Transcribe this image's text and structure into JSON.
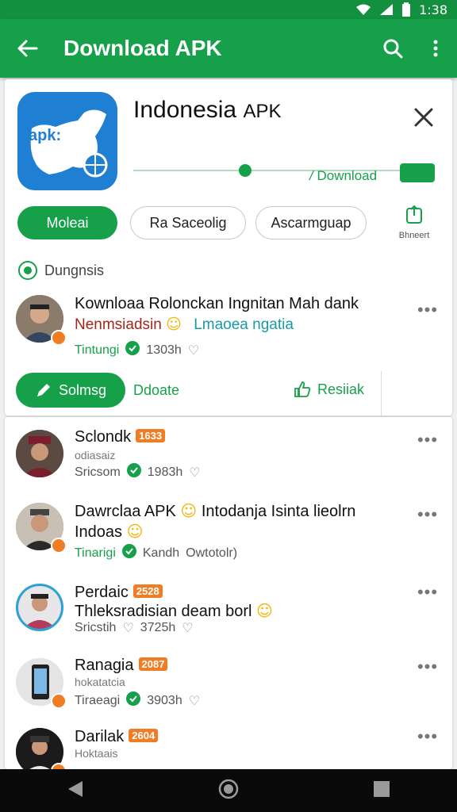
{
  "status_bar": {
    "time": "1:38"
  },
  "app_bar": {
    "title": "Download APK"
  },
  "app": {
    "icon_text": "apk:",
    "title": "Indonesia",
    "title_suffix": "APK",
    "download_label": "Download",
    "progress": 0.37
  },
  "chips": [
    "Moleai",
    "Ra Saceolig",
    "Ascarmguap"
  ],
  "share": {
    "label": "Bhneert"
  },
  "section": {
    "title": "Dungnsis"
  },
  "featured_post": {
    "title": "Kownloaa Rolonckan Ingnitan Mah dank",
    "sub_user": "Nenmsiadsin",
    "sub_text": "Lmaoea ngatia",
    "meta_name": "Tintungi",
    "meta_time": "1303h"
  },
  "actions": {
    "primary": "Solmsg",
    "secondary": "Ddoate",
    "like": "Resiiak"
  },
  "posts": [
    {
      "name": "Sclondk",
      "tag": "1633",
      "handle": "odiasaiz",
      "meta": "Sricsom",
      "time": "1983h"
    },
    {
      "name": "Dawrclaa APK",
      "line1_rest": "Intodanja Isinta lieolrn",
      "line2": "Indoas",
      "meta": "Tinarigi",
      "time": "Kandh",
      "extra": "Owtotolr)"
    },
    {
      "name": "Perdaic",
      "tag": "2528",
      "line2": "Thleksradisian deam borl",
      "meta": "Sricstih",
      "time": "3725h"
    },
    {
      "name": "Ranagia",
      "tag": "2087",
      "handle": "hokatatcia",
      "meta": "Tiraeagi",
      "time": "3903h"
    },
    {
      "name": "Darilak",
      "tag": "2604",
      "handle": "Hoktaais"
    }
  ]
}
